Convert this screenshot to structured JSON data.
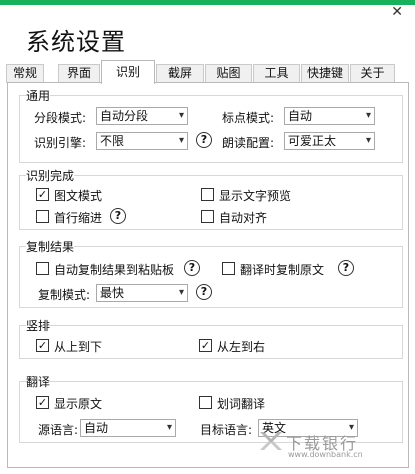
{
  "window": {
    "title": "系统设置",
    "close_glyph": "✕"
  },
  "tabs": [
    {
      "label": "常规",
      "active": false
    },
    {
      "label": "界面",
      "active": false
    },
    {
      "label": "识别",
      "active": true
    },
    {
      "label": "截屏",
      "active": false
    },
    {
      "label": "贴图",
      "active": false
    },
    {
      "label": "工具",
      "active": false
    },
    {
      "label": "快捷键",
      "active": false
    },
    {
      "label": "关于",
      "active": false
    }
  ],
  "general": {
    "title": "通用",
    "segment_mode_label": "分段模式:",
    "segment_mode_value": "自动分段",
    "punctuation_mode_label": "标点模式:",
    "punctuation_mode_value": "自动",
    "engine_label": "识别引擎:",
    "engine_value": "不限",
    "tts_label": "朗读配置:",
    "tts_value": "可爱正太"
  },
  "recognition_done": {
    "title": "识别完成",
    "image_mode": {
      "label": "图文模式",
      "checked": true
    },
    "show_preview": {
      "label": "显示文字预览",
      "checked": false
    },
    "first_line_indent": {
      "label": "首行缩进",
      "checked": false
    },
    "auto_align": {
      "label": "自动对齐",
      "checked": false
    }
  },
  "copy_result": {
    "title": "复制结果",
    "auto_copy_clipboard": {
      "label": "自动复制结果到粘贴板",
      "checked": false
    },
    "copy_original_on_translate": {
      "label": "翻译时复制原文",
      "checked": false
    },
    "copy_mode_label": "复制模式:",
    "copy_mode_value": "最快"
  },
  "vertical": {
    "title": "竖排",
    "top_to_bottom": {
      "label": "从上到下",
      "checked": true
    },
    "left_to_right": {
      "label": "从左到右",
      "checked": true
    }
  },
  "translate": {
    "title": "翻译",
    "show_original": {
      "label": "显示原文",
      "checked": true
    },
    "select_translate": {
      "label": "划词翻译",
      "checked": false
    },
    "source_lang_label": "源语言:",
    "source_lang_value": "自动",
    "target_lang_label": "目标语言:",
    "target_lang_value": "英文"
  },
  "watermark": {
    "main": "下载银行",
    "sub": "www.downbank.cn"
  },
  "icons": {
    "help": "?",
    "dropdown": "▾",
    "check": "✓"
  },
  "colors": {
    "accent_bar": "#19b05c",
    "border": "#b9b9b9"
  }
}
